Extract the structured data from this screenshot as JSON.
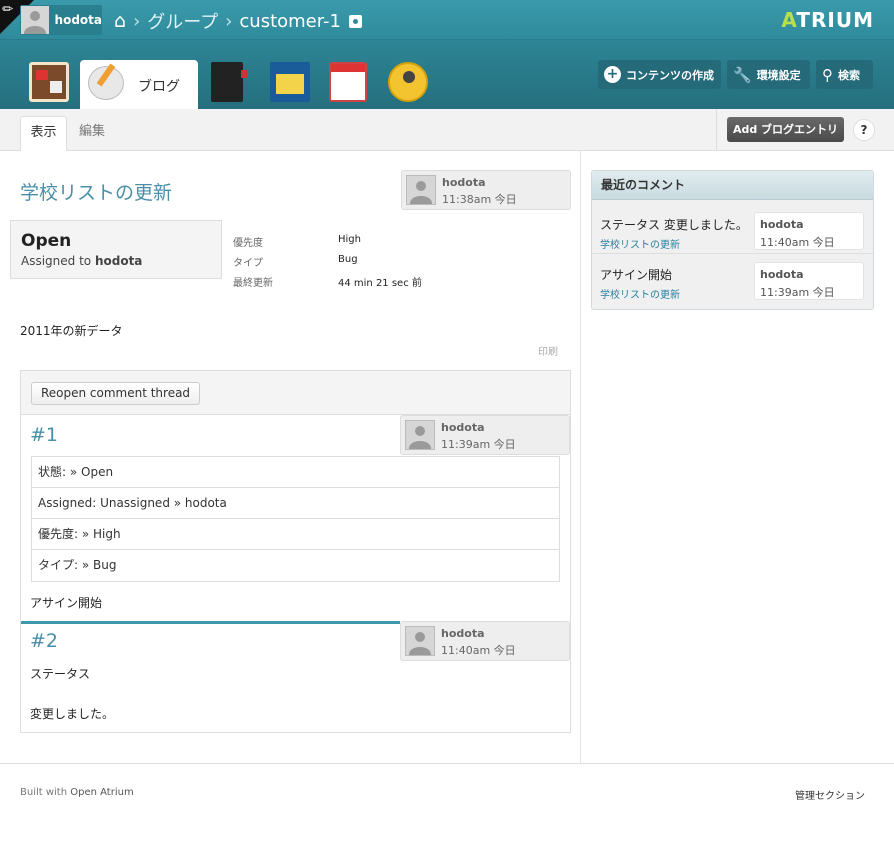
{
  "topbar": {
    "user": "hodota",
    "breadcrumb": [
      "グループ",
      "customer-1"
    ],
    "logo_a": "A",
    "logo_rest": "TRIUM"
  },
  "nav": {
    "active_tab_label": "ブログ",
    "buttons": {
      "create": "コンテンツの作成",
      "settings": "環境設定",
      "search": "検索"
    }
  },
  "subnav": {
    "tabs": [
      "表示",
      "編集"
    ],
    "add_button": "Add ブログエントリ",
    "help": "?"
  },
  "post": {
    "title": "学校リストの更新",
    "author": "hodota",
    "timestamp": "11:38am 今日",
    "status": "Open",
    "assigned_prefix": "Assigned to ",
    "assigned_to": "hodota",
    "meta": [
      {
        "label": "優先度",
        "value": "High"
      },
      {
        "label": "タイプ",
        "value": "Bug"
      },
      {
        "label": "最終更新",
        "value": "44 min 21 sec 前"
      }
    ],
    "body": "2011年の新データ",
    "print": "印刷"
  },
  "thread": {
    "reopen_button": "Reopen comment thread",
    "comments": [
      {
        "number": "#1",
        "author": "hodota",
        "timestamp": "11:39am 今日",
        "changes": [
          "状態: » Open",
          "Assigned: Unassigned » hodota",
          "優先度: » High",
          "タイプ: » Bug"
        ],
        "text": "アサイン開始"
      },
      {
        "number": "#2",
        "author": "hodota",
        "timestamp": "11:40am 今日",
        "text_lines": [
          "ステータス",
          "変更しました。"
        ]
      }
    ]
  },
  "recent_comments": {
    "title": "最近のコメント",
    "items": [
      {
        "text": "ステータス 変更しました。",
        "link": "学校リストの更新",
        "author": "hodota",
        "time": "11:40am 今日"
      },
      {
        "text": "アサイン開始",
        "link": "学校リストの更新",
        "author": "hodota",
        "time": "11:39am 今日"
      }
    ]
  },
  "footer": {
    "built_with": "Built with ",
    "built_link": "Open Atrium",
    "admin": "管理セクション"
  }
}
